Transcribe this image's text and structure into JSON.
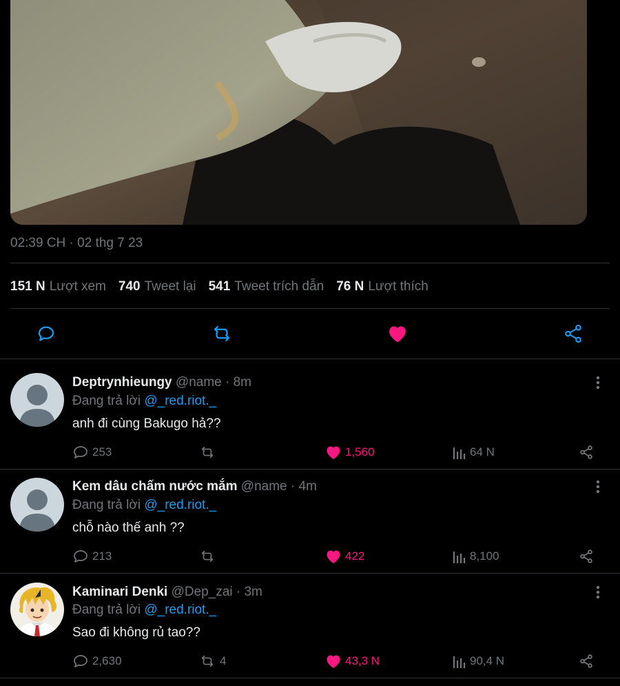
{
  "tweet": {
    "timestamp": "02:39 CH · 02 thg 7 23",
    "stats": [
      {
        "value": "151 N",
        "label": "Lượt xem"
      },
      {
        "value": "740",
        "label": "Tweet lại"
      },
      {
        "value": "541",
        "label": "Tweet trích dẫn"
      },
      {
        "value": "76 N",
        "label": "Lượt thích"
      }
    ],
    "actions": {
      "reply_icon": "reply-icon",
      "retweet_icon": "retweet-icon",
      "like_icon": "heart-filled-icon",
      "share_icon": "share-icon"
    },
    "colors": {
      "like": "#f91880",
      "mention": "#1d9bf0",
      "muted": "#71767b"
    }
  },
  "replies": [
    {
      "name": "Deptrynhieungy",
      "handle": "@name · 8m",
      "replying_prefix": "Đang trả lời ",
      "replying_to": "@_red.riot._",
      "text": "anh đi cùng Bakugo hả??",
      "reply_count": "253",
      "retweet_count": "",
      "like_count": "1,560",
      "view_count": "64 N",
      "avatar": "default-avatar"
    },
    {
      "name": "Kem dâu chấm nước mắm",
      "handle": "@name · 4m",
      "replying_prefix": "Đang trả lời ",
      "replying_to": "@_red.riot._",
      "text": "chỗ nào thế anh ??",
      "reply_count": "213",
      "retweet_count": "",
      "like_count": "422",
      "view_count": "8,100",
      "avatar": "default-avatar"
    },
    {
      "name": "Kaminari Denki",
      "handle": "@Dep_zai · 3m",
      "replying_prefix": "Đang trả lời ",
      "replying_to": "@_red.riot._",
      "text": "Sao đi không rủ tao??",
      "reply_count": "2,630",
      "retweet_count": "4",
      "like_count": "43,3 N",
      "view_count": "90,4 N",
      "avatar": "anime-character-avatar"
    }
  ]
}
